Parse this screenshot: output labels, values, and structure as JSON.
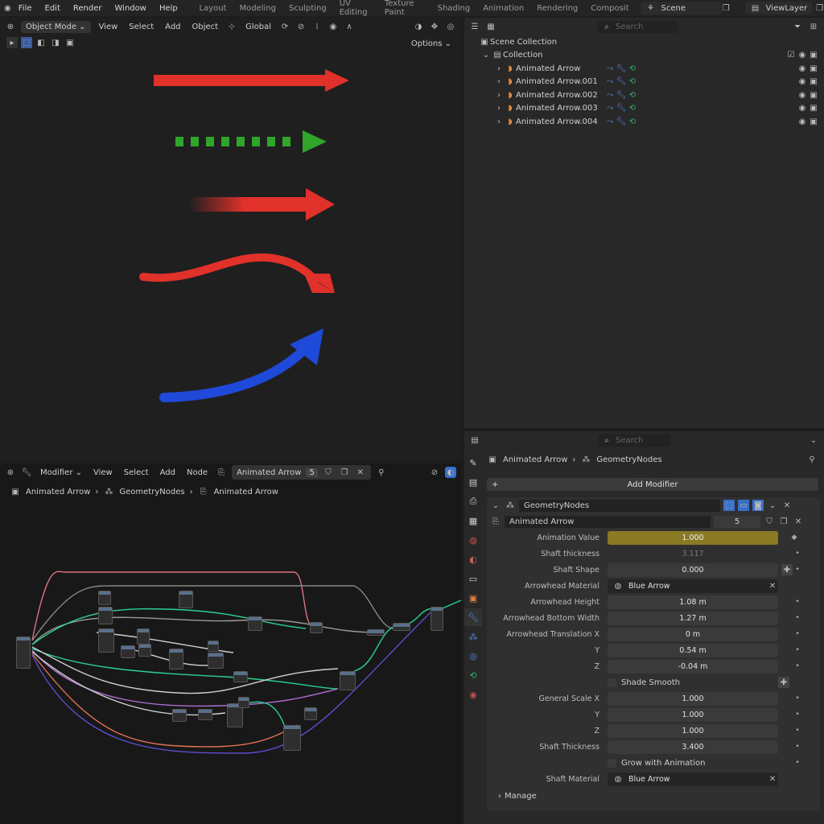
{
  "menu": {
    "file": "File",
    "edit": "Edit",
    "render": "Render",
    "window": "Window",
    "help": "Help"
  },
  "workspaces": [
    "Layout",
    "Modeling",
    "Sculpting",
    "UV Editing",
    "Texture Paint",
    "Shading",
    "Animation",
    "Rendering",
    "Composit"
  ],
  "scene": {
    "name": "Scene",
    "view_layer": "ViewLayer"
  },
  "viewport": {
    "mode": "Object Mode",
    "view": "View",
    "select": "Select",
    "add": "Add",
    "object": "Object",
    "orientation": "Global",
    "options": "Options",
    "arrow_colors": {
      "red": "#e0312a",
      "green": "#2fa52a",
      "blue": "#1f49d8"
    }
  },
  "outliner": {
    "search_placeholder": "Search",
    "scene_collection": "Scene Collection",
    "collection": "Collection",
    "items": [
      {
        "label": "Animated Arrow"
      },
      {
        "label": "Animated Arrow.001"
      },
      {
        "label": "Animated Arrow.002"
      },
      {
        "label": "Animated Arrow.003"
      },
      {
        "label": "Animated Arrow.004"
      }
    ]
  },
  "node_editor": {
    "editor": "Modifier",
    "view": "View",
    "select": "Select",
    "add": "Add",
    "node": "Node",
    "object": "Animated Arrow",
    "users": "5",
    "breadcrumb": [
      "Animated Arrow",
      "GeometryNodes",
      "Animated Arrow"
    ]
  },
  "properties": {
    "search_placeholder": "Search",
    "breadcrumb": [
      "Animated Arrow",
      "GeometryNodes"
    ],
    "add_modifier": "Add Modifier",
    "modifier_name": "GeometryNodes",
    "node_group": "Animated Arrow",
    "node_group_users": "5",
    "rows": [
      {
        "label": "Animation Value",
        "value": "1.000",
        "style": "yellow"
      },
      {
        "label": "Shaft thickness",
        "value": "3.117",
        "style": "dim"
      },
      {
        "label": "Shaft Shape",
        "value": "0.000",
        "style": "normal"
      },
      {
        "label": "Arrowhead Material",
        "value": "Blue Arrow",
        "style": "mat"
      },
      {
        "label": "Arrowhead Height",
        "value": "1.08 m",
        "style": "normal"
      },
      {
        "label": "Arrowhead Bottom Width",
        "value": "1.27 m",
        "style": "normal"
      },
      {
        "label": "Arrowhead Translation X",
        "value": "0 m",
        "style": "normal"
      },
      {
        "label": "Y",
        "value": "0.54 m",
        "style": "normal"
      },
      {
        "label": "Z",
        "value": "-0.04 m",
        "style": "normal"
      }
    ],
    "shade_smooth": "Shade Smooth",
    "scale_rows": [
      {
        "label": "General Scale X",
        "value": "1.000"
      },
      {
        "label": "Y",
        "value": "1.000"
      },
      {
        "label": "Z",
        "value": "1.000"
      },
      {
        "label": "Shaft Thickness",
        "value": "3.400"
      }
    ],
    "grow": "Grow with Animation",
    "shaft_material_label": "Shaft Material",
    "shaft_material": "Blue Arrow",
    "manage": "Manage"
  }
}
